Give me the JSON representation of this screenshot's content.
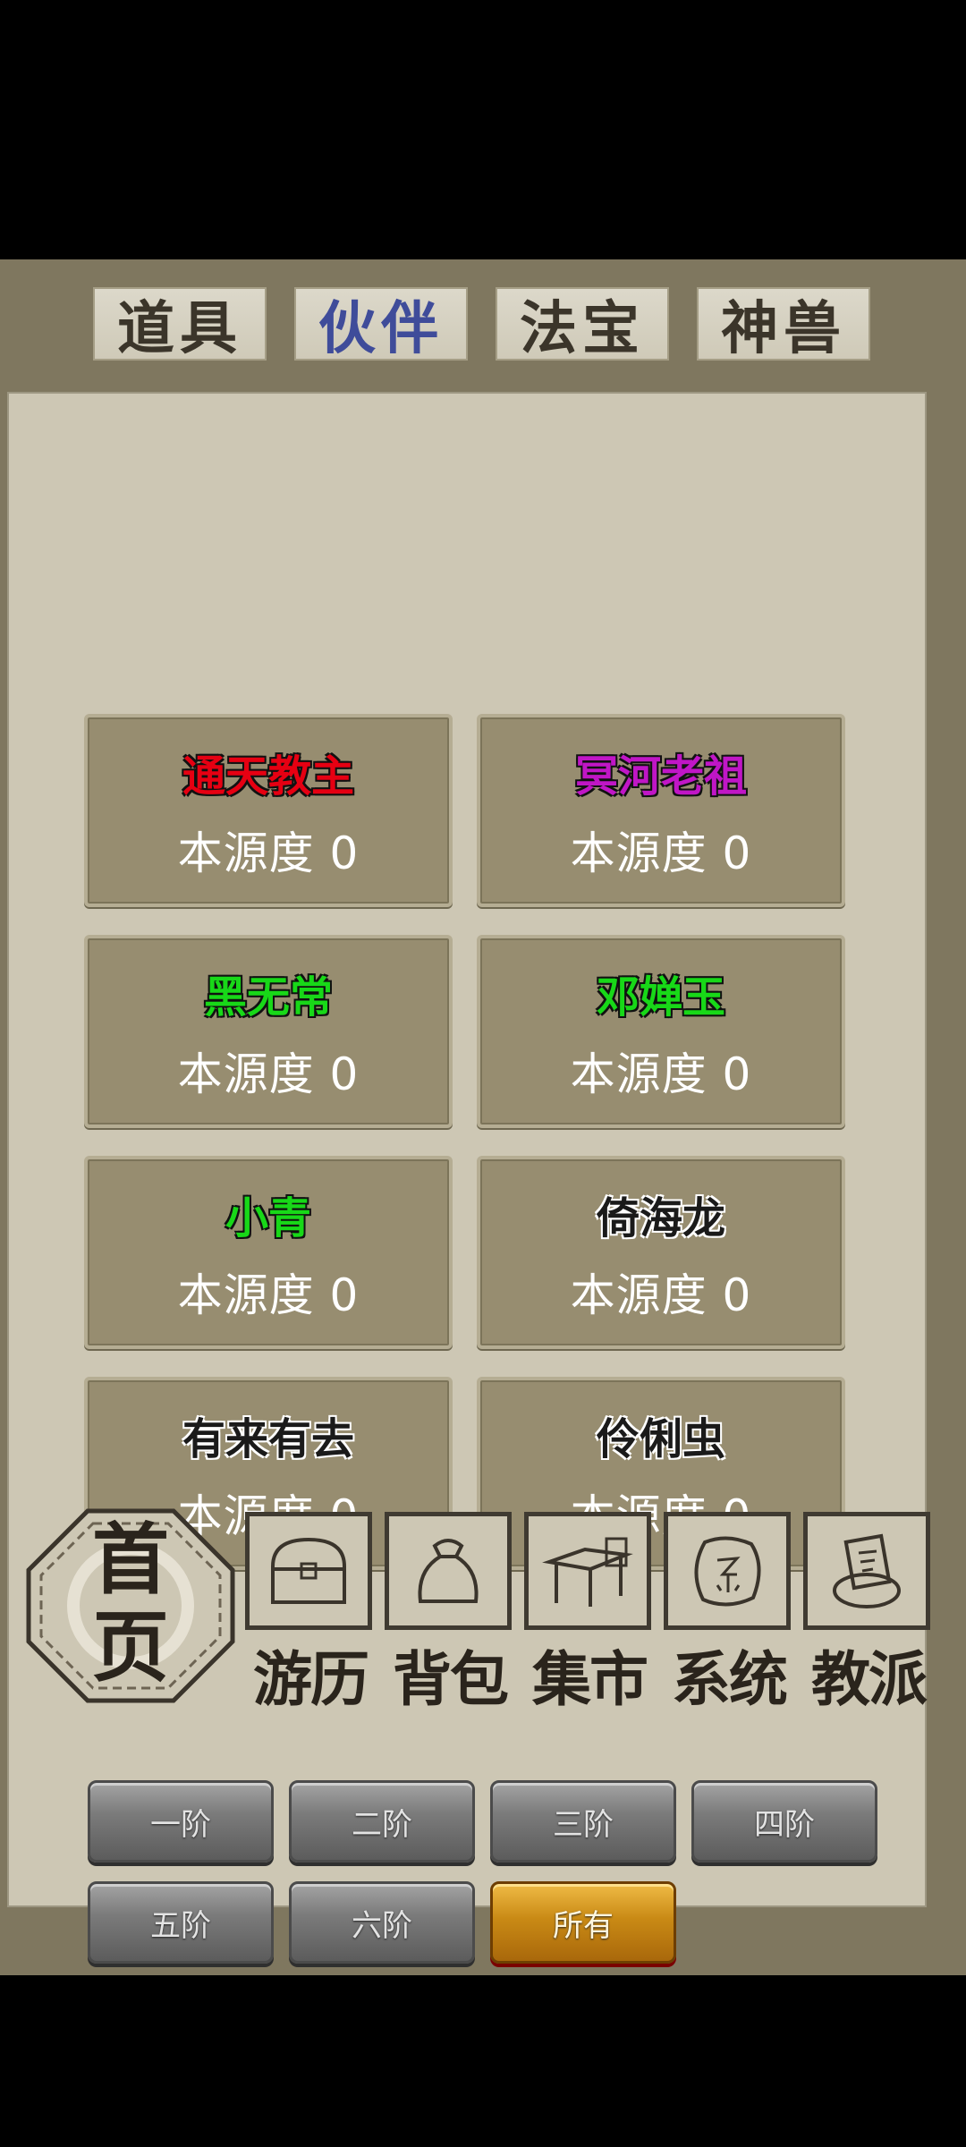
{
  "tabs": [
    {
      "label": "道具",
      "active": false
    },
    {
      "label": "伙伴",
      "active": true
    },
    {
      "label": "法宝",
      "active": false
    },
    {
      "label": "神兽",
      "active": false
    }
  ],
  "companions": [
    {
      "name": "通天教主",
      "stat": "本源度 0",
      "color": "red"
    },
    {
      "name": "冥河老祖",
      "stat": "本源度 0",
      "color": "purple"
    },
    {
      "name": "黑无常",
      "stat": "本源度 0",
      "color": "green"
    },
    {
      "name": "邓婵玉",
      "stat": "本源度 0",
      "color": "green"
    },
    {
      "name": "小青",
      "stat": "本源度 0",
      "color": "green"
    },
    {
      "name": "倚海龙",
      "stat": "本源度 0",
      "color": "plain"
    },
    {
      "name": "有来有去",
      "stat": "本源度 0",
      "color": "plain"
    },
    {
      "name": "伶俐虫",
      "stat": "本源度 0",
      "color": "plain"
    }
  ],
  "ranks": [
    {
      "label": "一阶",
      "active": false
    },
    {
      "label": "二阶",
      "active": false
    },
    {
      "label": "三阶",
      "active": false
    },
    {
      "label": "四阶",
      "active": false
    },
    {
      "label": "五阶",
      "active": false
    },
    {
      "label": "六阶",
      "active": false
    },
    {
      "label": "所有",
      "active": true
    }
  ],
  "nav": {
    "home": {
      "label_top": "首",
      "label_bottom": "页",
      "icon": "octagon-emblem-icon"
    },
    "items": [
      {
        "label": "游历",
        "icon": "chest-icon"
      },
      {
        "label": "背包",
        "icon": "bag-icon"
      },
      {
        "label": "集市",
        "icon": "market-stall-icon"
      },
      {
        "label": "系统",
        "icon": "system-seal-icon"
      },
      {
        "label": "教派",
        "icon": "sect-scroll-icon"
      }
    ]
  },
  "colors": {
    "red": "#e60012",
    "purple": "#c016c6",
    "green": "#18d818",
    "tab_active": "#3f4c9a",
    "gold": "#c98a15"
  }
}
